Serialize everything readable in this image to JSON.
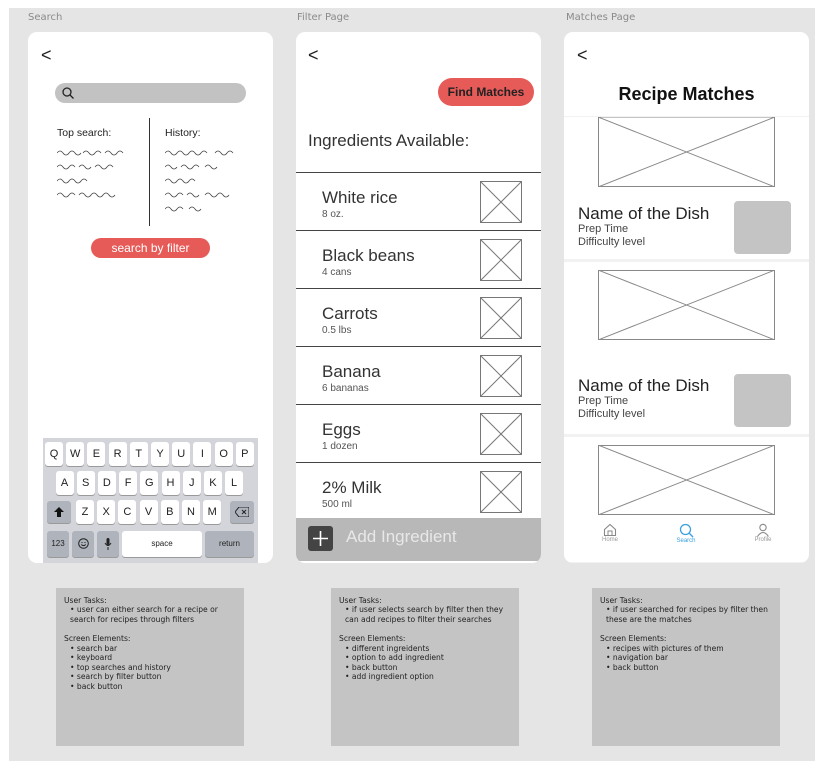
{
  "frames": {
    "search": "Search",
    "filter": "Filter Page",
    "matches": "Matches Page"
  },
  "search_screen": {
    "back": "<",
    "top_search_label": "Top search:",
    "history_label": "History:",
    "filter_button": "search by filter",
    "keyboard": {
      "row1": [
        "Q",
        "W",
        "E",
        "R",
        "T",
        "Y",
        "U",
        "I",
        "O",
        "P"
      ],
      "row2": [
        "A",
        "S",
        "D",
        "F",
        "G",
        "H",
        "J",
        "K",
        "L"
      ],
      "row3": [
        "Z",
        "X",
        "C",
        "V",
        "B",
        "N",
        "M"
      ],
      "numbers_key": "123",
      "space_key": "space",
      "return_key": "return"
    }
  },
  "filter_screen": {
    "back": "<",
    "find_button": "Find Matches",
    "heading": "Ingredients Available:",
    "ingredients": [
      {
        "name": "White rice",
        "qty": "8 oz."
      },
      {
        "name": "Black beans",
        "qty": "4 cans"
      },
      {
        "name": "Carrots",
        "qty": "0.5 lbs"
      },
      {
        "name": "Banana",
        "qty": "6 bananas"
      },
      {
        "name": "Eggs",
        "qty": "1 dozen"
      },
      {
        "name": "2% Milk",
        "qty": "500 ml"
      }
    ],
    "add_label": "Add Ingredient"
  },
  "matches_screen": {
    "back": "<",
    "title": "Recipe Matches",
    "dishes": [
      {
        "name": "Name of the Dish",
        "prep": "Prep Time",
        "difficulty": "Difficulty level"
      },
      {
        "name": "Name of the Dish",
        "prep": "Prep Time",
        "difficulty": "Difficulty level"
      }
    ],
    "nav": {
      "home": "Home",
      "search": "Search",
      "profile": "Profile",
      "active_color": "#3aa0e0"
    }
  },
  "notes": {
    "search": {
      "tasks_title": "User Tasks:",
      "tasks": [
        "user can either search for a recipe or search for recipes through filters"
      ],
      "elements_title": "Screen Elements:",
      "elements": [
        "search bar",
        "keyboard",
        "top searches and history",
        "search by filter button",
        "back button"
      ]
    },
    "filter": {
      "tasks_title": "User Tasks:",
      "tasks": [
        "if user selects search by filter then they can add recipes to filter their searches"
      ],
      "elements_title": "Screen Elements:",
      "elements": [
        "different ingreidents",
        "option to add ingredient",
        "back button",
        "add ingredient option"
      ]
    },
    "matches": {
      "tasks_title": "User Tasks:",
      "tasks": [
        "if user searched for recipes by filter then these are the matches"
      ],
      "elements_title": "Screen Elements:",
      "elements": [
        "recipes with pictures of them",
        "navigation bar",
        "back button"
      ]
    }
  },
  "colors": {
    "accent_red": "#e65a58",
    "placeholder_gray": "#c4c4c4"
  }
}
